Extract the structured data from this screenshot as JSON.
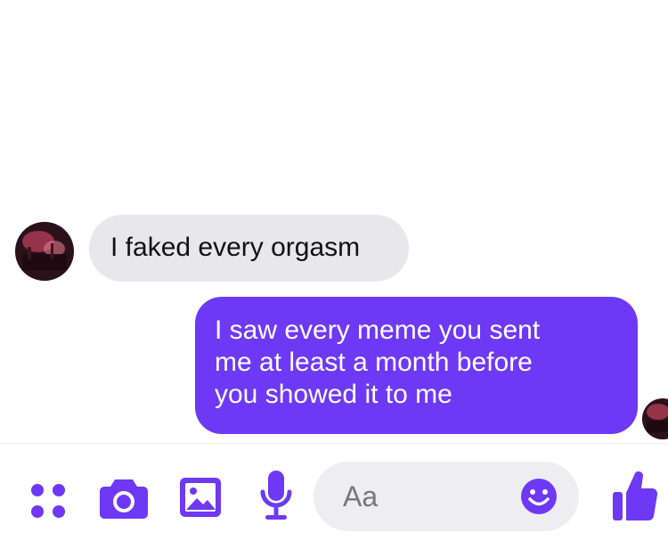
{
  "messages": {
    "received": {
      "text": "I faked every orgasm"
    },
    "sent": {
      "lines": [
        "I saw every meme you sent",
        "me at least a month before",
        "you showed it to me"
      ]
    }
  },
  "composer": {
    "input_placeholder": "Aa",
    "icons": [
      "apps-icon",
      "camera-icon",
      "image-icon",
      "microphone-icon",
      "emoji-icon",
      "thumbs-up-icon"
    ]
  },
  "colors": {
    "accent": "#6d39f4",
    "received_bubble": "#e8e8ea",
    "input_bg": "#eeeef0"
  }
}
